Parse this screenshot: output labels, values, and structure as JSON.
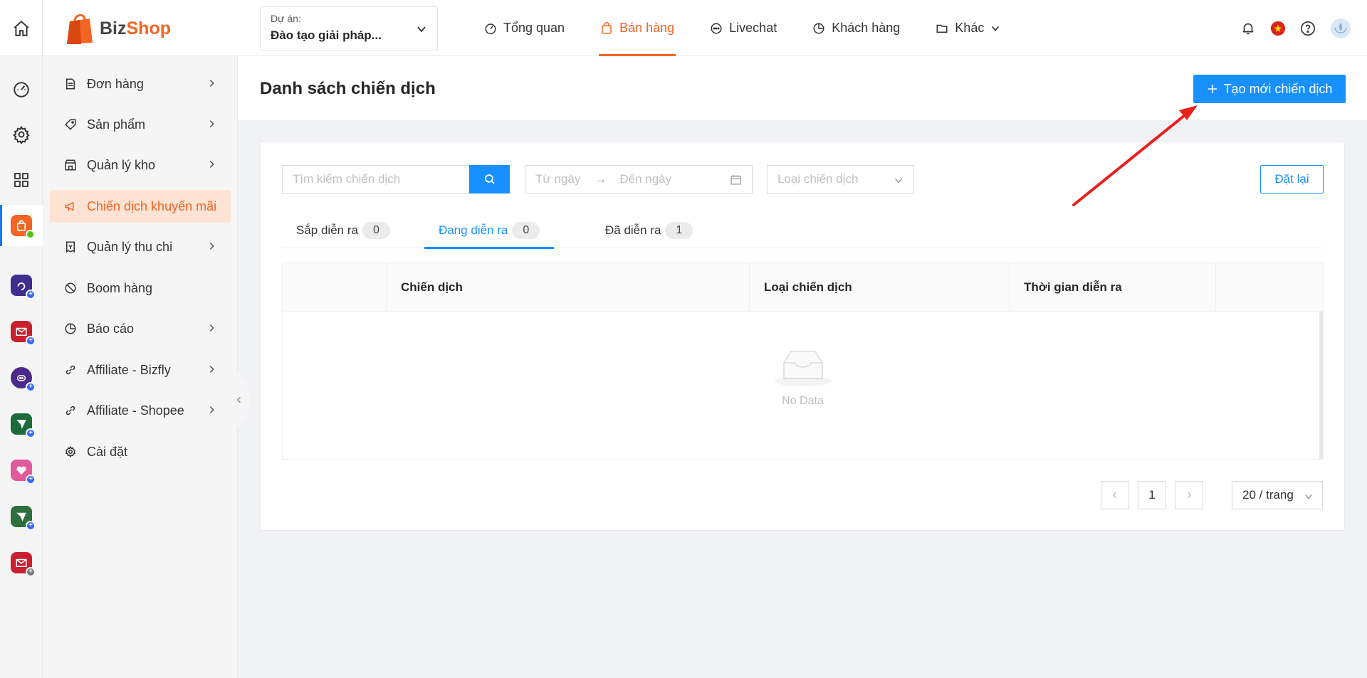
{
  "brand": {
    "biz": "Biz",
    "shop": "Shop"
  },
  "project": {
    "label": "Dự án:",
    "value": "Đào tạo giải pháp..."
  },
  "nav": {
    "overview": "Tổng quan",
    "sales": "Bán hàng",
    "livechat": "Livechat",
    "customers": "Khách hàng",
    "other": "Khác"
  },
  "sidebar": {
    "orders": "Đơn hàng",
    "products": "Sản phẩm",
    "warehouse": "Quản lý kho",
    "campaigns": "Chiến dịch khuyến mãi",
    "finance": "Quản lý thu chi",
    "boom": "Boom hàng",
    "reports": "Báo cáo",
    "affiliate_bizfly": "Affiliate - Bizfly",
    "affiliate_shopee": "Affiliate - Shopee",
    "settings": "Cài đặt"
  },
  "page": {
    "title": "Danh sách chiến dịch",
    "create_label": "Tạo mới chiến dịch"
  },
  "filters": {
    "search_placeholder": "Tìm kiếm chiến dịch",
    "from_date": "Từ ngày",
    "to_date": "Đến ngày",
    "type_placeholder": "Loại chiến dịch",
    "reset_label": "Đặt lại"
  },
  "tabs": [
    {
      "label": "Sắp diễn ra",
      "count": "0"
    },
    {
      "label": "Đang diễn ra",
      "count": "0"
    },
    {
      "label": "Đã diễn ra",
      "count": "1"
    }
  ],
  "table": {
    "columns": [
      "Chiến dịch",
      "Loại chiến dịch",
      "Thời gian diễn ra"
    ],
    "empty_text": "No Data"
  },
  "pagination": {
    "current_page": "1",
    "page_size": "20 / trang"
  },
  "colors": {
    "accent": "#f26522",
    "primary": "#1890ff",
    "annotation": "#e8201c"
  }
}
